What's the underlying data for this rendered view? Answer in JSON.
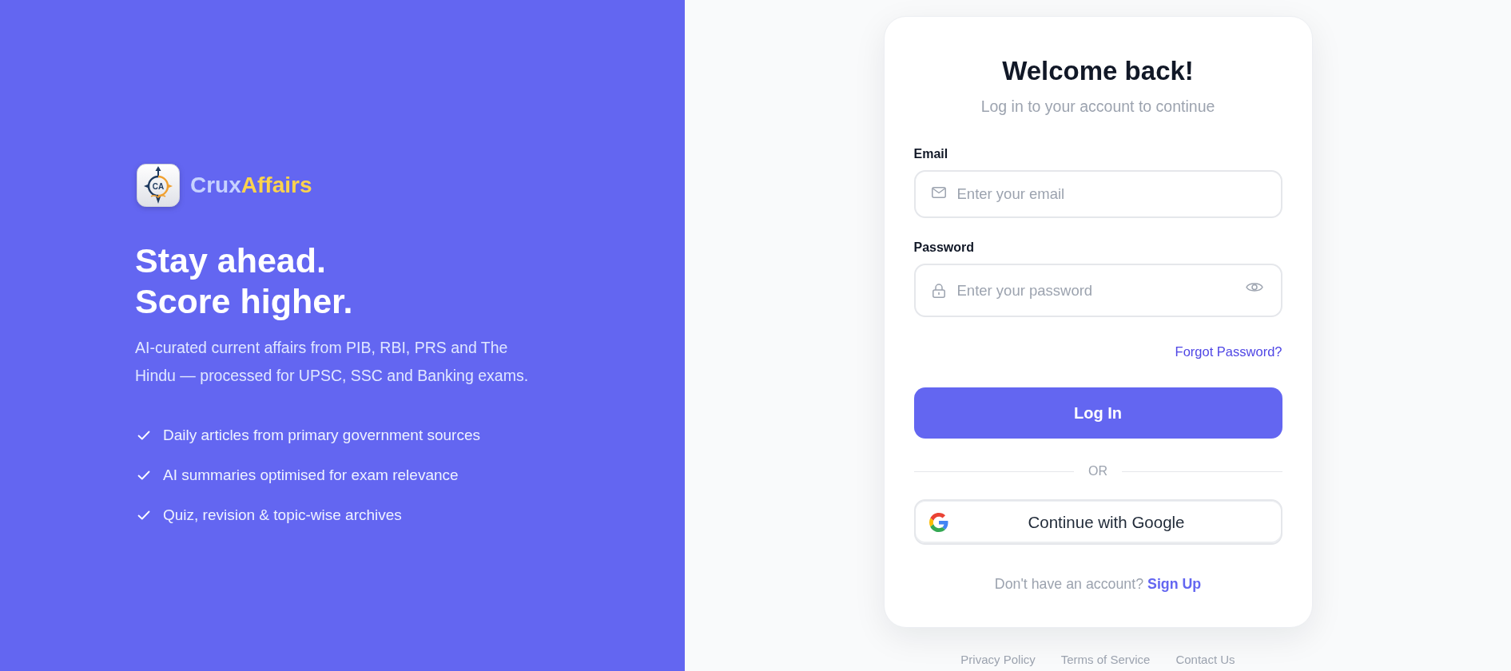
{
  "brand_panel": {
    "logo": {
      "monogram": "CA"
    },
    "brand": {
      "name": "Crux",
      "highlight": "Affairs"
    },
    "headline": [
      "Stay ahead.",
      "Score higher."
    ],
    "description": "AI-curated current affairs from PIB, RBI, PRS and The Hindu — processed for UPSC, SSC and Banking exams.",
    "features": [
      "Daily articles from primary government sources",
      "AI summaries optimised for exam relevance",
      "Quiz, revision & topic-wise archives"
    ]
  },
  "login_card": {
    "title": "Welcome back!",
    "subtitle": "Log in to your account to continue",
    "fields": [
      {
        "kind": "email",
        "label": "Email",
        "placeholder": "Enter your email"
      },
      {
        "kind": "password",
        "label": "Password",
        "placeholder": "Enter your password"
      }
    ],
    "forgot_link": "Forgot Password?",
    "submit_button": "Log In",
    "divider": "OR",
    "google_button": "Continue with Google",
    "signup_prompt": {
      "text": "Don't have an account?",
      "link": "Sign Up"
    }
  },
  "footer_links": [
    "Privacy Policy",
    "Terms of Service",
    "Contact Us"
  ]
}
